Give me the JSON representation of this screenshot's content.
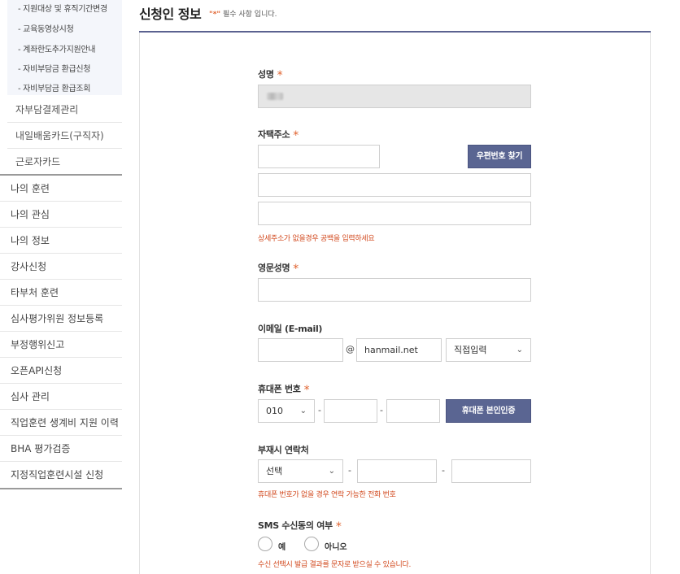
{
  "sidebar": {
    "sub_items": [
      "- 지원대상 및 휴직기간변경",
      "- 교육동영상시청",
      "- 계좌한도추가지원안내",
      "- 자비부담금 환급신청",
      "- 자비부담금 환급조회"
    ],
    "mid_items": [
      "자부담결제관리",
      "내일배움카드(구직자)",
      "근로자카드"
    ],
    "top_items": [
      "나의 훈련",
      "나의 관심",
      "나의 정보",
      "강사신청",
      "타부처 훈련",
      "심사평가위원 정보등록",
      "부정행위신고",
      "오픈API신청",
      "심사 관리",
      "직업훈련 생계비 지원 이력",
      "BHA 평가검증",
      "지정직업훈련시설 신청"
    ]
  },
  "header": {
    "title": "신청인 정보",
    "required_mark": "\"*\"",
    "required_text": "필수 사항 입니다."
  },
  "form": {
    "name": {
      "label": "성명",
      "required": "*"
    },
    "address": {
      "label": "자택주소",
      "required": "*",
      "zip_button": "우편번호 찾기",
      "help": "상세주소가 없을경우 공백을 입력하세요"
    },
    "english_name": {
      "label": "영문성명",
      "required": "*"
    },
    "email": {
      "label": "이메일 (E-mail)",
      "at": "@",
      "domain_value": "hanmail.net",
      "domain_select": "직접입력"
    },
    "mobile": {
      "label": "휴대폰 번호",
      "required": "*",
      "prefix": "010",
      "dash": "-",
      "verify_button": "휴대폰 본인인증"
    },
    "alt_phone": {
      "label": "부재시 연락처",
      "prefix": "선택",
      "dash": "-",
      "help": "휴대폰 번호가 없을 경우 연락 가능한 전화 번호"
    },
    "sms": {
      "label": "SMS 수신동의 여부",
      "required": "*",
      "yes": "예",
      "no": "아니오",
      "help": "수신 선택시 발급 결과를 문자로 받으실 수 있습니다."
    }
  },
  "icons": {
    "chevron": "chevron-down-icon"
  },
  "colors": {
    "accent": "#5a6592",
    "required": "#e0622e",
    "help": "#d2491e"
  }
}
